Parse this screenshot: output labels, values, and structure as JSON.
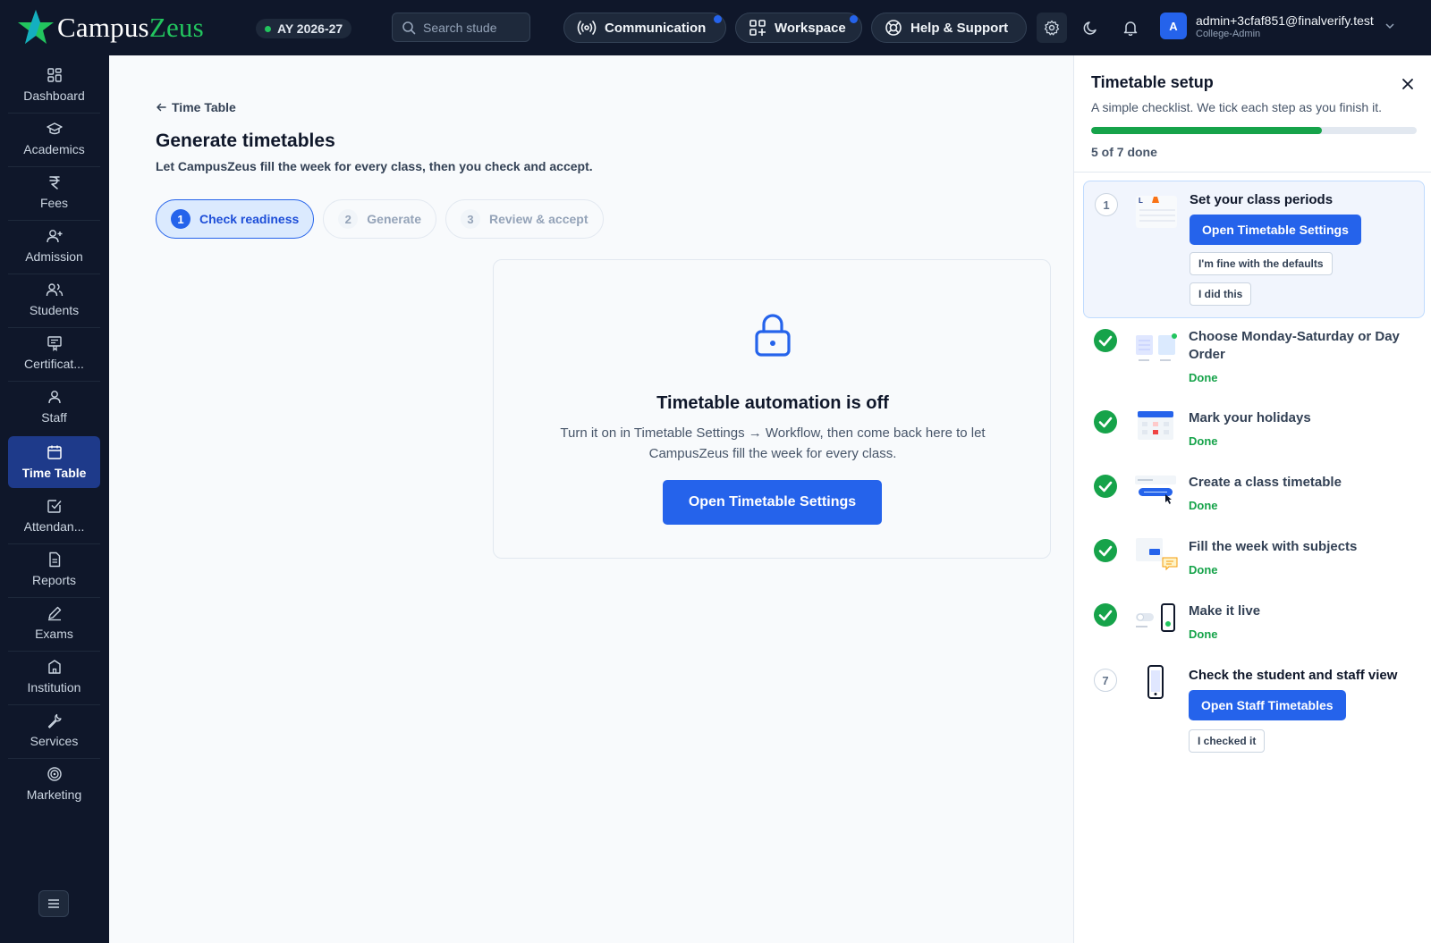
{
  "app": {
    "brand_prefix": "Campus",
    "brand_accent": "Zeus",
    "academic_year": "AY 2026-27"
  },
  "header": {
    "search_placeholder": "Search stude",
    "communication_label": "Communication",
    "workspace_label": "Workspace",
    "help_label": "Help & Support",
    "user_initial": "A",
    "user_email": "admin+3cfaf851@finalverify.test",
    "user_role": "College-Admin"
  },
  "sidebar": {
    "items": [
      {
        "label": "Dashboard",
        "icon": "dashboard-icon"
      },
      {
        "label": "Academics",
        "icon": "graduation-cap-icon"
      },
      {
        "label": "Fees",
        "icon": "rupee-icon"
      },
      {
        "label": "Admission",
        "icon": "user-plus-icon"
      },
      {
        "label": "Students",
        "icon": "users-icon"
      },
      {
        "label": "Certificat...",
        "icon": "certificate-icon"
      },
      {
        "label": "Staff",
        "icon": "user-icon"
      },
      {
        "label": "Time Table",
        "icon": "calendar-icon"
      },
      {
        "label": "Attendan...",
        "icon": "checkbox-icon"
      },
      {
        "label": "Reports",
        "icon": "file-icon"
      },
      {
        "label": "Exams",
        "icon": "pen-icon"
      },
      {
        "label": "Institution",
        "icon": "building-icon"
      },
      {
        "label": "Services",
        "icon": "wrench-icon"
      },
      {
        "label": "Marketing",
        "icon": "target-icon"
      }
    ],
    "active_index": 7
  },
  "main": {
    "back_label": "Time Table",
    "title": "Generate timetables",
    "subtitle": "Let CampusZeus fill the week for every class, then you check and accept.",
    "steps": [
      {
        "num": "1",
        "label": "Check readiness"
      },
      {
        "num": "2",
        "label": "Generate"
      },
      {
        "num": "3",
        "label": "Review & accept"
      }
    ],
    "active_step": 0,
    "card": {
      "title": "Timetable automation is off",
      "body": "Turn it on in Timetable Settings → Workflow, then come back here to let CampusZeus fill the week for every class.",
      "button": "Open Timetable Settings"
    }
  },
  "setup": {
    "title": "Timetable setup",
    "subtitle": "A simple checklist. We tick each step as you finish it.",
    "progress_fraction": 0.71,
    "progress_text": "5 of 7 done",
    "done_label": "Done",
    "tasks": [
      {
        "num": "1",
        "title": "Set your class periods",
        "status": "current",
        "primary": "Open Timetable Settings",
        "secondary": [
          "I'm fine with the defaults",
          "I did this"
        ]
      },
      {
        "num": "2",
        "title": "Choose Monday-Saturday or Day Order",
        "status": "done"
      },
      {
        "num": "3",
        "title": "Mark your holidays",
        "status": "done"
      },
      {
        "num": "4",
        "title": "Create a class timetable",
        "status": "done"
      },
      {
        "num": "5",
        "title": "Fill the week with subjects",
        "status": "done"
      },
      {
        "num": "6",
        "title": "Make it live",
        "status": "done"
      },
      {
        "num": "7",
        "title": "Check the student and staff view",
        "status": "pending",
        "primary": "Open Staff Timetables",
        "secondary": [
          "I checked it"
        ]
      }
    ]
  },
  "colors": {
    "primary": "#2563eb",
    "success": "#16a34a",
    "nav_bg": "#0f172a",
    "brand_accent": "#22c55e"
  }
}
